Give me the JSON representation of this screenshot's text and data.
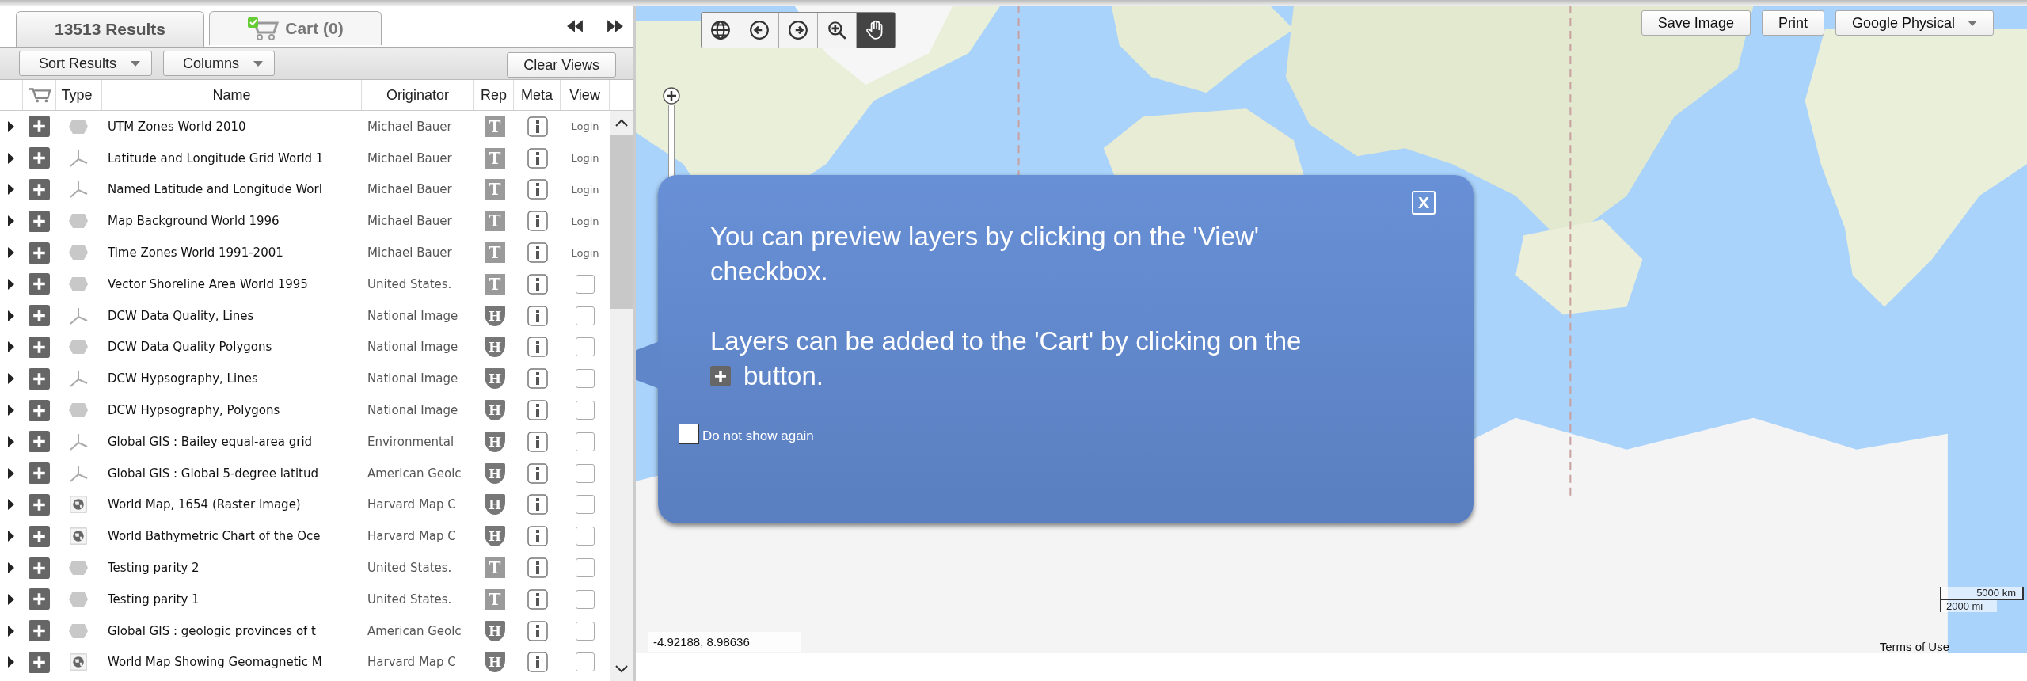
{
  "tabs": [
    {
      "label": "13513 Results",
      "kind": "results",
      "selected": true
    },
    {
      "label": "Cart (0)",
      "kind": "cart",
      "selected": false
    }
  ],
  "toolbar": {
    "sort": "Sort Results",
    "columns": "Columns",
    "clear": "Clear Views"
  },
  "table": {
    "columns": [
      "Type",
      "Name",
      "Originator",
      "Rep",
      "Meta",
      "View"
    ],
    "rows": [
      {
        "kind": "polygon",
        "name": "UTM Zones World 2010",
        "originator": "Michael Bauer",
        "rep": {
          "letter": "T",
          "kind": "square"
        },
        "view": {
          "kind": "login",
          "text": "Login"
        }
      },
      {
        "kind": "line",
        "name": "Latitude and Longitude Grid World 1",
        "originator": "Michael Bauer",
        "rep": {
          "letter": "T",
          "kind": "square"
        },
        "view": {
          "kind": "login",
          "text": "Login"
        }
      },
      {
        "kind": "line",
        "name": "Named Latitude and Longitude Worl",
        "originator": "Michael Bauer",
        "rep": {
          "letter": "T",
          "kind": "square"
        },
        "view": {
          "kind": "login",
          "text": "Login"
        }
      },
      {
        "kind": "polygon",
        "name": "Map Background World 1996",
        "originator": "Michael Bauer",
        "rep": {
          "letter": "T",
          "kind": "square"
        },
        "view": {
          "kind": "login",
          "text": "Login"
        }
      },
      {
        "kind": "polygon",
        "name": "Time Zones World 1991-2001",
        "originator": "Michael Bauer",
        "rep": {
          "letter": "T",
          "kind": "square"
        },
        "view": {
          "kind": "login",
          "text": "Login"
        }
      },
      {
        "kind": "polygon",
        "name": "Vector Shoreline Area World 1995",
        "originator": "United States.",
        "rep": {
          "letter": "T",
          "kind": "square"
        },
        "view": {
          "kind": "checkbox",
          "checked": false
        }
      },
      {
        "kind": "line",
        "name": "DCW Data Quality, Lines",
        "originator": "National Image",
        "rep": {
          "letter": "H",
          "kind": "shield"
        },
        "view": {
          "kind": "checkbox",
          "checked": false
        }
      },
      {
        "kind": "polygon",
        "name": "DCW Data Quality Polygons",
        "originator": "National Image",
        "rep": {
          "letter": "H",
          "kind": "shield"
        },
        "view": {
          "kind": "checkbox",
          "checked": false
        }
      },
      {
        "kind": "line",
        "name": "DCW Hypsography, Lines",
        "originator": "National Image",
        "rep": {
          "letter": "H",
          "kind": "shield"
        },
        "view": {
          "kind": "checkbox",
          "checked": false
        }
      },
      {
        "kind": "polygon",
        "name": "DCW Hypsography, Polygons",
        "originator": "National Image",
        "rep": {
          "letter": "H",
          "kind": "shield"
        },
        "view": {
          "kind": "checkbox",
          "checked": false
        }
      },
      {
        "kind": "line",
        "name": "Global GIS : Bailey equal-area grid",
        "originator": "Environmental",
        "rep": {
          "letter": "H",
          "kind": "shield"
        },
        "view": {
          "kind": "checkbox",
          "checked": false
        }
      },
      {
        "kind": "line",
        "name": "Global GIS : Global 5-degree latitud",
        "originator": "American Geolc",
        "rep": {
          "letter": "H",
          "kind": "shield"
        },
        "view": {
          "kind": "checkbox",
          "checked": false
        }
      },
      {
        "kind": "raster",
        "name": "World Map, 1654 (Raster Image)",
        "originator": "Harvard Map C",
        "rep": {
          "letter": "H",
          "kind": "shield"
        },
        "view": {
          "kind": "checkbox",
          "checked": false
        }
      },
      {
        "kind": "raster",
        "name": "World Bathymetric Chart of the Oce",
        "originator": "Harvard Map C",
        "rep": {
          "letter": "H",
          "kind": "shield"
        },
        "view": {
          "kind": "checkbox",
          "checked": false
        }
      },
      {
        "kind": "polygon",
        "name": "Testing parity 2",
        "originator": "United States.",
        "rep": {
          "letter": "T",
          "kind": "square"
        },
        "view": {
          "kind": "checkbox",
          "checked": false
        }
      },
      {
        "kind": "polygon",
        "name": "Testing parity 1",
        "originator": "United States.",
        "rep": {
          "letter": "T",
          "kind": "square"
        },
        "view": {
          "kind": "checkbox",
          "checked": false
        }
      },
      {
        "kind": "polygon",
        "name": "Global GIS : geologic provinces of t",
        "originator": "American Geolc",
        "rep": {
          "letter": "H",
          "kind": "shield"
        },
        "view": {
          "kind": "checkbox",
          "checked": false
        }
      },
      {
        "kind": "raster",
        "name": "World Map Showing Geomagnetic M",
        "originator": "Harvard Map C",
        "rep": {
          "letter": "H",
          "kind": "shield"
        },
        "view": {
          "kind": "checkbox",
          "checked": false
        }
      }
    ]
  },
  "map": {
    "tools": [
      {
        "kind": "globe",
        "selected": false
      },
      {
        "kind": "back",
        "selected": false
      },
      {
        "kind": "forward",
        "selected": false
      },
      {
        "kind": "zoom",
        "selected": false
      },
      {
        "kind": "pan",
        "selected": true
      }
    ],
    "buttons": [
      "Save Image",
      "Print"
    ],
    "basemap": "Google Physical",
    "coordinates": "-4.92188, 8.98636",
    "scale": [
      "5000 km",
      "2000 mi"
    ],
    "terms": "Terms of Use"
  },
  "popup": {
    "close": "X",
    "paragraph_1": "You can preview layers by clicking on the 'View' checkbox.",
    "paragraph_2_before": "Layers can be added to the 'Cart' by clicking on the",
    "paragraph_2_after": "button.",
    "dont_show": {
      "label": "Do not show again",
      "checked": false
    }
  }
}
